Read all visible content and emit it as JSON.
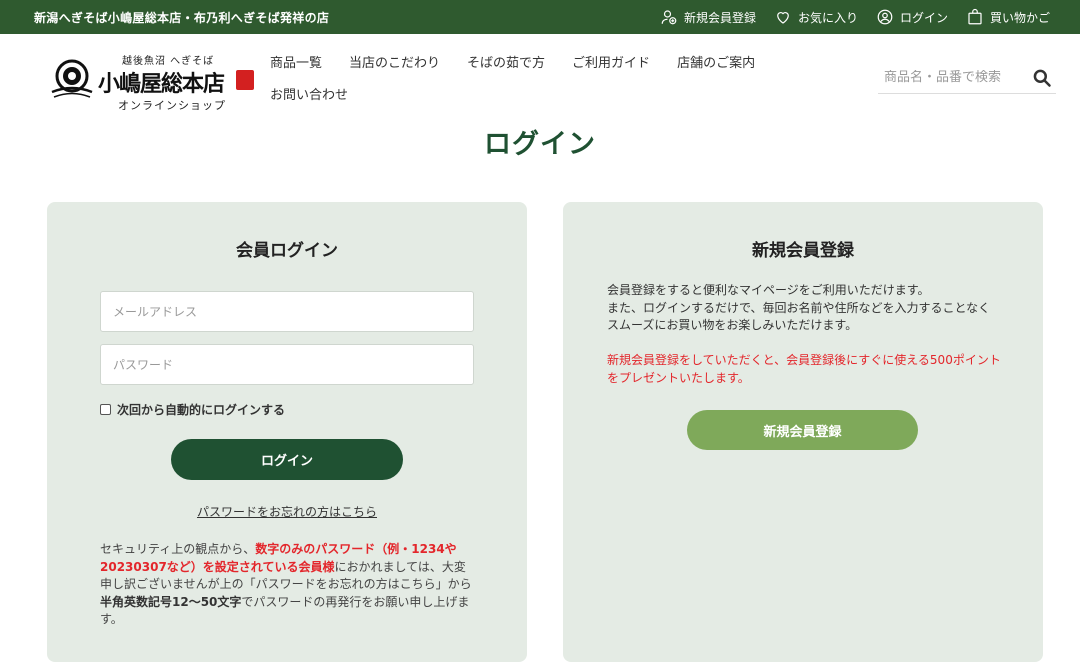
{
  "topbar": {
    "tagline": "新潟へぎそば小嶋屋総本店・布乃利へぎそば発祥の店",
    "links": {
      "register": "新規会員登録",
      "favorites": "お気に入り",
      "login": "ログイン",
      "cart": "買い物かご"
    }
  },
  "logo": {
    "top_text": "越後魚沼 へぎそば",
    "brand": "小嶋屋総本店",
    "sub": "オンラインショップ"
  },
  "nav": {
    "products": "商品一覧",
    "commitment": "当店のこだわり",
    "boiling": "そばの茹で方",
    "guide": "ご利用ガイド",
    "stores": "店舗のご案内",
    "contact": "お問い合わせ"
  },
  "search": {
    "placeholder": "商品名・品番で検索"
  },
  "page_title": "ログイン",
  "member_login": {
    "heading": "会員ログイン",
    "email_placeholder": "メールアドレス",
    "password_placeholder": "パスワード",
    "remember_label": "次回から自動的にログインする",
    "checked": false,
    "submit": "ログイン",
    "forgot": "パスワードをお忘れの方はこちら",
    "notice": {
      "p1": "セキュリティ上の観点から、",
      "red": "数字のみのパスワード（例・1234や20230307など）を設定されている会員様",
      "p2": "におかれましては、大変申し訳ございませんが上の「パスワードをお忘れの方はこちら」から",
      "bold": "半角英数記号12〜50文字",
      "p3": "でパスワードの再発行をお願い申し上げます。"
    }
  },
  "new_member": {
    "heading": "新規会員登録",
    "intro": "会員登録をすると便利なマイページをご利用いただけます。\nまた、ログインするだけで、毎回お名前や住所などを入力することなくスムーズにお買い物をお楽しみいただけます。",
    "bonus": "新規会員登録をしていただくと、会員登録後にすぐに使える500ポイントをプレゼントいたします。",
    "button": "新規会員登録"
  },
  "colors": {
    "topbar": "#2f5a2f",
    "title": "#1f5132",
    "login_button": "#1f5132",
    "register_button": "#7fa95a",
    "card_bg": "#e4ebe4",
    "alert": "#e3262b"
  },
  "icons": {
    "register": "user-plus-icon",
    "favorites": "heart-icon",
    "login": "user-circle-icon",
    "cart": "shopping-bag-icon",
    "search": "search-icon"
  }
}
